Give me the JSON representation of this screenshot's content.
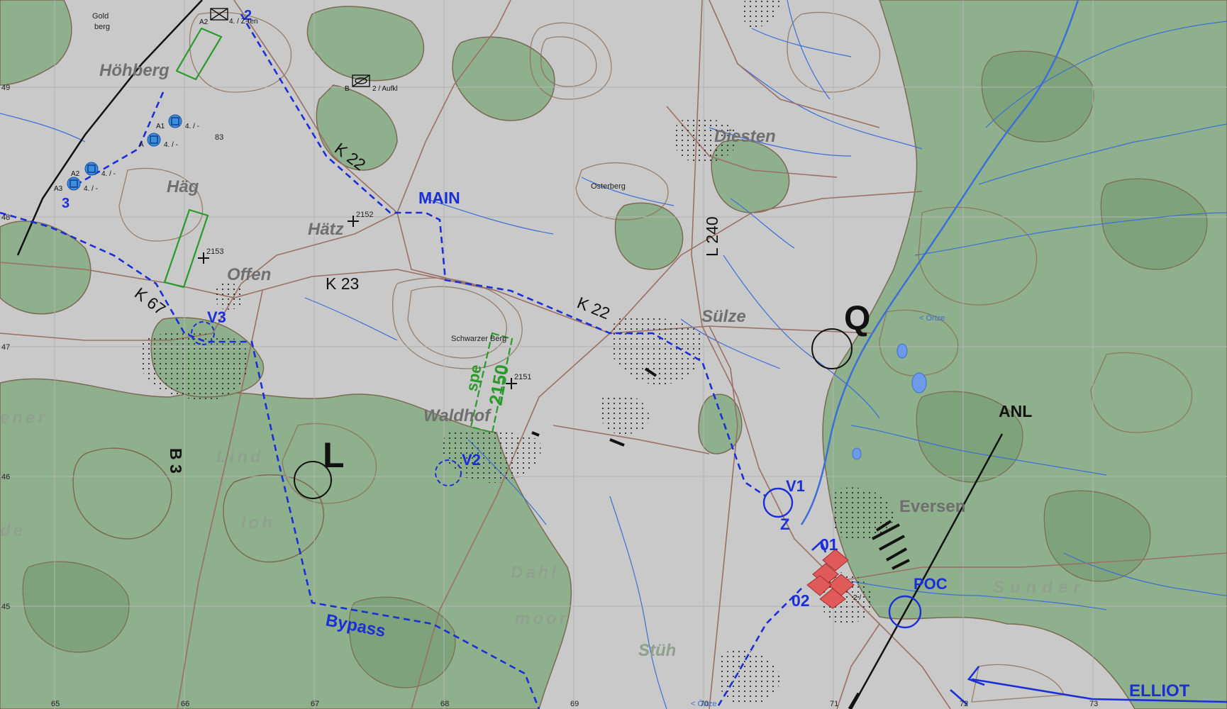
{
  "map": {
    "colors": {
      "open_ground": "#c9c9c9",
      "forest": "#8fb08c",
      "forest_dark": "#7ea37b",
      "contour": "#8a6d55",
      "road": "#9b6f63",
      "water": "#3c6fd6",
      "grid": "#b4b4b4",
      "friendly_route": "#1a2fd6",
      "hostile": "#e15a5a",
      "own_unit": "#3b8fe0",
      "boundary": "#111111",
      "zone": "#2a9a2a"
    },
    "places": {
      "hoehberg": "Höhberg",
      "haeg": "Häg",
      "haetz": "Hätz",
      "offen": "Offen",
      "diesten": "Diesten",
      "suelze": "Sülze",
      "waldhof": "Waldhof",
      "eversen": "Eversen",
      "dahl": "Dahl",
      "moor": "moor",
      "stueh": "Stüh",
      "sunder": "Sunder",
      "lind": "Lind",
      "loh": "loh",
      "ener": "ener",
      "de": "de",
      "goldberg_1": "Gold",
      "goldberg_2": "berg",
      "osterberg": "Osterberg",
      "schwarzer_berg": "Schwarzer Berg",
      "oertze_1": "< Örtze",
      "oertze_2": "< Örtze"
    },
    "roads": {
      "k22_a": "K 22",
      "k22_b": "K 22",
      "k23": "K 23",
      "k67": "K 67",
      "l240": "L 240",
      "b3": "B 3"
    },
    "routes": {
      "main": "MAIN",
      "bypass": "Bypass",
      "elliot": "ELLIOT",
      "anl": "ANL"
    },
    "points": {
      "q": "Q",
      "l": "L",
      "v1": "V1",
      "v2": "V2",
      "v3": "V3",
      "z": "Z",
      "poc": "POC",
      "p01": "01",
      "p02": "02"
    },
    "spot_heights": {
      "h2152": "2152",
      "h2153": "2153",
      "h2151": "2151",
      "h83": "83"
    },
    "zone": {
      "name": "spe",
      "number": "2150"
    },
    "units": {
      "unit2_number": "2",
      "unit2_label": "4. / Z-ren",
      "unit2_prefix": "A2",
      "aufkl_label": "2 / Aufkl",
      "aufkl_prefix": "B",
      "unit3_number": "3",
      "a1": "A1",
      "a": "A",
      "a2": "A2",
      "a3": "A3",
      "a1_label": "4. / -",
      "a_label": "4. / -",
      "a2_label": "4. / -",
      "a3_label": "4. / -",
      "enemy_label": "2 /"
    },
    "grid": {
      "x_labels": [
        "65",
        "66",
        "67",
        "68",
        "69",
        "70",
        "71",
        "72",
        "73"
      ],
      "y_labels": [
        "49",
        "48",
        "47",
        "46",
        "45"
      ]
    }
  }
}
